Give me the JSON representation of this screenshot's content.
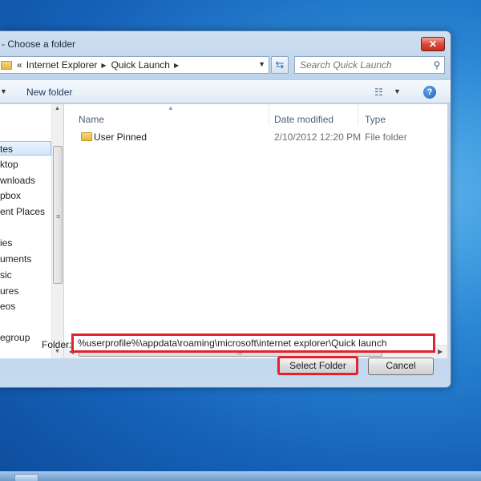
{
  "window": {
    "title": "- Choose a folder",
    "close_label": "✕"
  },
  "address": {
    "overflow": "«",
    "crumbs": [
      "Internet Explorer",
      "Quick Launch"
    ]
  },
  "search": {
    "placeholder": "Search Quick Launch"
  },
  "toolbar": {
    "new_folder_label": "New folder"
  },
  "nav": {
    "items": [
      {
        "label": "tes",
        "selected": true
      },
      {
        "label": "ktop"
      },
      {
        "label": "wnloads"
      },
      {
        "label": "pbox"
      },
      {
        "label": "ent Places"
      },
      {
        "label": "ies"
      },
      {
        "label": "uments"
      },
      {
        "label": "sic"
      },
      {
        "label": "ures"
      },
      {
        "label": "eos"
      },
      {
        "label": "egroup"
      }
    ]
  },
  "columns": {
    "name": "Name",
    "date": "Date modified",
    "type": "Type"
  },
  "files": [
    {
      "name": "User Pinned",
      "date": "2/10/2012 12:20 PM",
      "type": "File folder"
    }
  ],
  "footer": {
    "folder_label": "Folder:",
    "folder_value": "%userprofile%\\appdata\\roaming\\microsoft\\internet explorer\\Quick launch",
    "select_label": "Select Folder",
    "cancel_label": "Cancel"
  },
  "colors": {
    "highlight_border": "#e0232d",
    "desktop": "#2a86d4"
  }
}
